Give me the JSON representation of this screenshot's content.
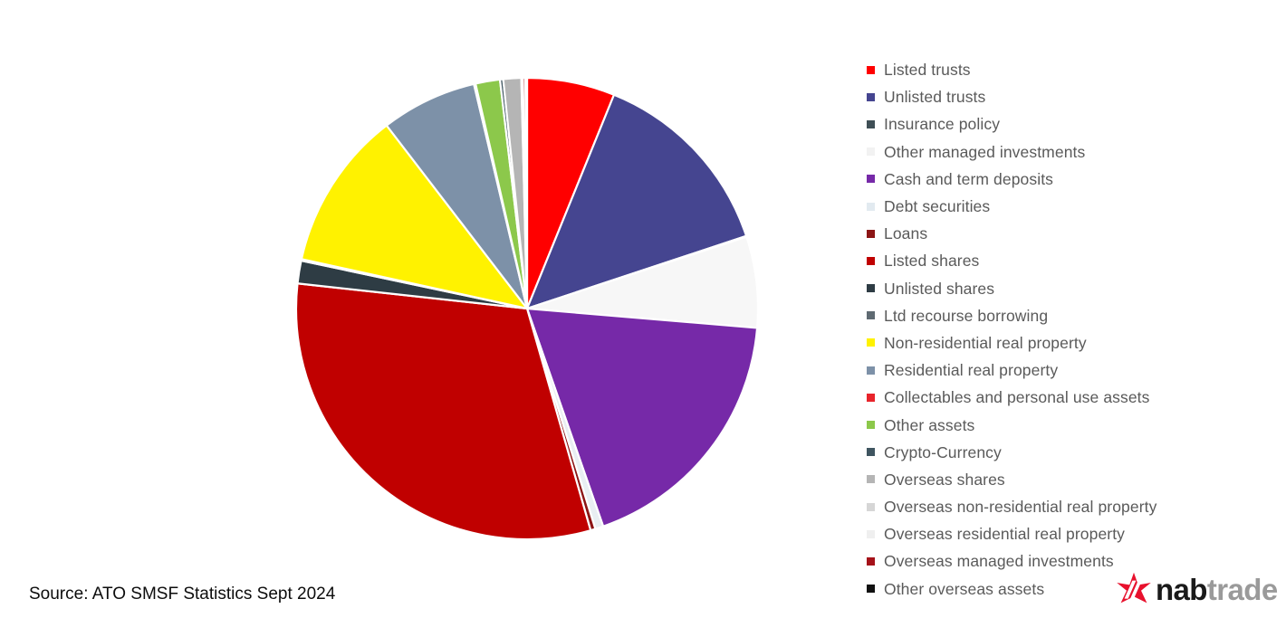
{
  "source_note": "Source: ATO SMSF Statistics Sept 2024",
  "logo": {
    "part1": "nab",
    "part2": "trade",
    "star_color": "#E8112D"
  },
  "chart_data": {
    "type": "pie",
    "title": "",
    "subtitle": "",
    "xlabel": "",
    "ylabel": "",
    "legend_position": "right",
    "grid": false,
    "start_angle_deg": 0,
    "direction": "clockwise",
    "units": "percent of total SMSF assets",
    "categories": [
      "Listed trusts",
      "Unlisted trusts",
      "Insurance policy",
      "Other managed investments",
      "Cash and term deposits",
      "Debt securities",
      "Loans",
      "Listed shares",
      "Unlisted shares",
      "Ltd recourse borrowing",
      "Non-residential real property",
      "Residential real property",
      "Collectables and personal use assets",
      "Other assets",
      "Crypto-Currency",
      "Overseas shares",
      "Overseas non-residential real property",
      "Overseas residential real property",
      "Overseas managed investments",
      "Other overseas assets"
    ],
    "values": [
      5.4,
      12.1,
      0.05,
      5.6,
      16.1,
      0.5,
      0.3,
      27.4,
      1.4,
      0.1,
      9.8,
      5.9,
      0.1,
      1.5,
      0.2,
      1.1,
      0.05,
      0.05,
      0.15,
      0.1
    ],
    "colors": [
      "#FF0000",
      "#454590",
      "#3F4F56",
      "#F7F7F7",
      "#7629A8",
      "#E8EEF2",
      "#8C1515",
      "#C00000",
      "#2E3C44",
      "#5F6A72",
      "#FFF200",
      "#7D91A8",
      "#E8242B",
      "#8CC84B",
      "#3F5560",
      "#B5B5B5",
      "#D6D6D6",
      "#F2F2F2",
      "#A51219",
      "#111111"
    ]
  },
  "legend": {
    "items": [
      {
        "label": "Listed trusts",
        "color": "#FF0000"
      },
      {
        "label": "Unlisted trusts",
        "color": "#454590"
      },
      {
        "label": "Insurance policy",
        "color": "#3F4F56"
      },
      {
        "label": "Other managed investments",
        "color": "#F2F2F2"
      },
      {
        "label": "Cash and term deposits",
        "color": "#7629A8"
      },
      {
        "label": "Debt securities",
        "color": "#E2EAF0"
      },
      {
        "label": "Loans",
        "color": "#8C1515"
      },
      {
        "label": "Listed shares",
        "color": "#C00000"
      },
      {
        "label": "Unlisted shares",
        "color": "#2E3C44"
      },
      {
        "label": "Ltd recourse borrowing",
        "color": "#5F6A72"
      },
      {
        "label": "Non-residential real property",
        "color": "#FFF200"
      },
      {
        "label": "Residential real property",
        "color": "#7D91A8"
      },
      {
        "label": "Collectables and personal use assets",
        "color": "#E8242B"
      },
      {
        "label": "Other assets",
        "color": "#8CC84B"
      },
      {
        "label": "Crypto-Currency",
        "color": "#3F5560"
      },
      {
        "label": "Overseas shares",
        "color": "#B5B5B5"
      },
      {
        "label": "Overseas non-residential real property",
        "color": "#D6D6D6"
      },
      {
        "label": "Overseas residential real property",
        "color": "#EFEFEF"
      },
      {
        "label": "Overseas managed investments",
        "color": "#A51219"
      },
      {
        "label": "Other overseas assets",
        "color": "#111111"
      }
    ]
  }
}
